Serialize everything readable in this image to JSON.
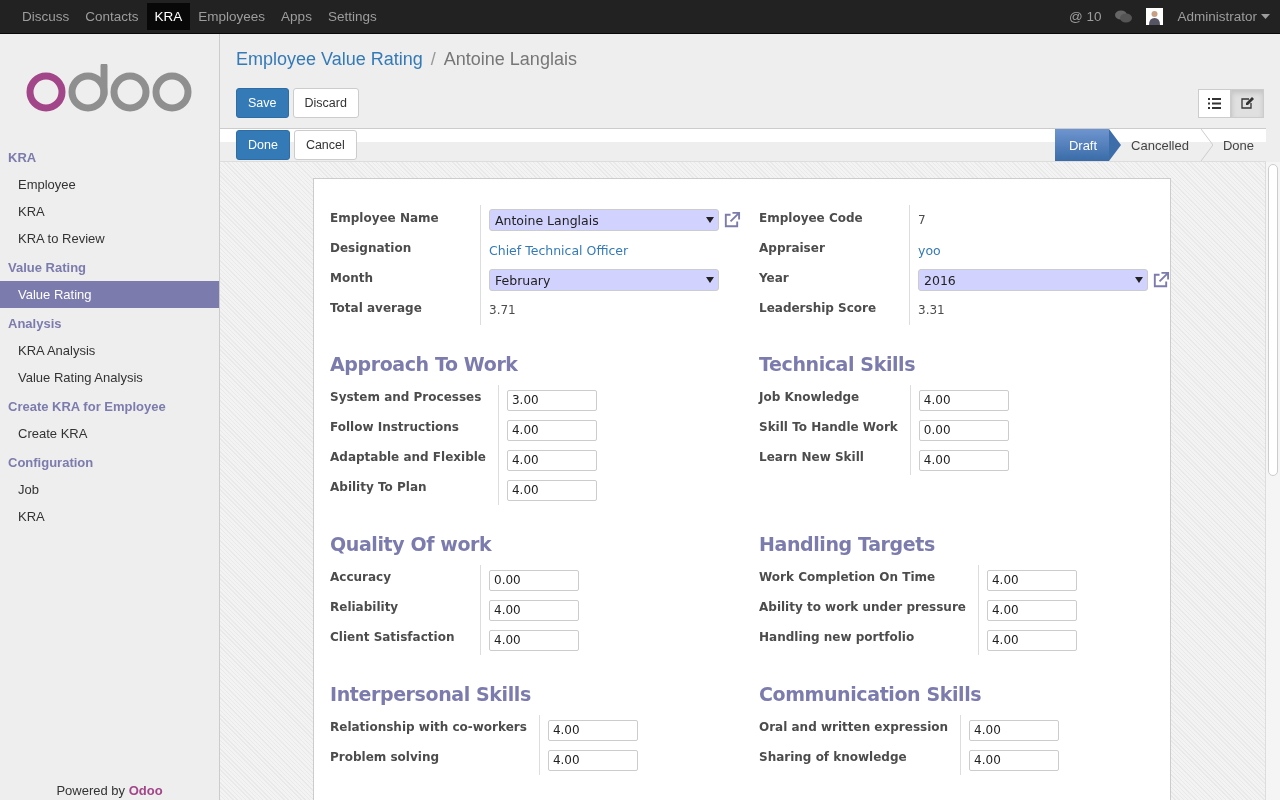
{
  "top_menu": [
    {
      "label": "Discuss",
      "selected": false
    },
    {
      "label": "Contacts",
      "selected": false
    },
    {
      "label": "KRA",
      "selected": true
    },
    {
      "label": "Employees",
      "selected": false
    },
    {
      "label": "Apps",
      "selected": false
    },
    {
      "label": "Settings",
      "selected": false
    }
  ],
  "top_right": {
    "mentions": "@ 10",
    "user": "Administrator"
  },
  "sidebar": {
    "groups": [
      {
        "heading": "KRA",
        "items": [
          {
            "label": "Employee",
            "selected": false
          },
          {
            "label": "KRA",
            "selected": false
          },
          {
            "label": "KRA to Review",
            "selected": false
          }
        ]
      },
      {
        "heading": "Value Rating",
        "items": [
          {
            "label": "Value Rating",
            "selected": true
          }
        ]
      },
      {
        "heading": "Analysis",
        "items": [
          {
            "label": "KRA Analysis",
            "selected": false
          },
          {
            "label": "Value Rating Analysis",
            "selected": false
          }
        ]
      },
      {
        "heading": "Create KRA for Employee",
        "items": [
          {
            "label": "Create KRA",
            "selected": false
          }
        ]
      },
      {
        "heading": "Configuration",
        "items": [
          {
            "label": "Job",
            "selected": false
          },
          {
            "label": "KRA",
            "selected": false
          }
        ]
      }
    ],
    "footer": "Powered by **Odoo**"
  },
  "breadcrumb": {
    "parent": "Employee Value Rating",
    "separator": "/",
    "current": "Antoine Langlais"
  },
  "buttons": [
    {
      "label": "Save",
      "kind": "primary"
    },
    {
      "label": "Discard",
      "kind": "default"
    }
  ],
  "view_switcher": [
    {
      "kind": "list",
      "selected": false
    },
    {
      "kind": "form",
      "selected": true
    }
  ],
  "status_bar": {
    "buttons": [
      {
        "label": "Done",
        "kind": "primary"
      },
      {
        "label": "Cancel",
        "kind": "default"
      }
    ],
    "stages": [
      {
        "label": "Draft",
        "selected": true
      },
      {
        "label": "Cancelled",
        "selected": false
      },
      {
        "label": "Done",
        "selected": false
      }
    ]
  },
  "header_fields": [
    [
      {
        "label": "Employee Name",
        "kind": "many2one",
        "value": "Antoine Langlais"
      },
      {
        "label": "Designation",
        "kind": "link",
        "value": "Chief Technical Officer"
      },
      {
        "label": "Month",
        "kind": "select",
        "value": "February"
      },
      {
        "label": "Total average",
        "kind": "text",
        "value": "3.71"
      }
    ],
    [
      {
        "label": "Employee Code",
        "kind": "text",
        "value": "7"
      },
      {
        "label": "Appraiser",
        "kind": "link",
        "value": "yoo"
      },
      {
        "label": "Year",
        "kind": "many2one",
        "value": "2016"
      },
      {
        "label": "Leadership Score",
        "kind": "text",
        "value": "3.31"
      }
    ]
  ],
  "sections": [
    {
      "title": "Approach To Work",
      "rows": [
        {
          "label": "System and Processes",
          "value": "3.00"
        },
        {
          "label": "Follow Instructions",
          "value": "4.00"
        },
        {
          "label": "Adaptable and Flexible",
          "value": "4.00"
        },
        {
          "label": "Ability To Plan",
          "value": "4.00"
        }
      ]
    },
    {
      "title": "Technical Skills",
      "rows": [
        {
          "label": "Job Knowledge",
          "value": "4.00"
        },
        {
          "label": "Skill To Handle Work",
          "value": "0.00"
        },
        {
          "label": "Learn New Skill",
          "value": "4.00"
        }
      ]
    },
    {
      "title": "Quality Of work",
      "rows": [
        {
          "label": "Accuracy",
          "value": "0.00"
        },
        {
          "label": "Reliability",
          "value": "4.00"
        },
        {
          "label": "Client Satisfaction",
          "value": "4.00"
        }
      ]
    },
    {
      "title": "Handling Targets",
      "rows": [
        {
          "label": "Work Completion On Time",
          "value": "4.00"
        },
        {
          "label": "Ability to work under pressure",
          "value": "4.00"
        },
        {
          "label": "Handling new portfolio",
          "value": "4.00"
        }
      ]
    },
    {
      "title": "Interpersonal Skills",
      "rows": [
        {
          "label": "Relationship with co-workers",
          "value": "4.00"
        },
        {
          "label": "Problem solving",
          "value": "4.00"
        }
      ]
    },
    {
      "title": "Communication Skills",
      "rows": [
        {
          "label": "Oral and written expression",
          "value": "4.00"
        },
        {
          "label": "Sharing of knowledge",
          "value": "4.00"
        }
      ]
    }
  ]
}
